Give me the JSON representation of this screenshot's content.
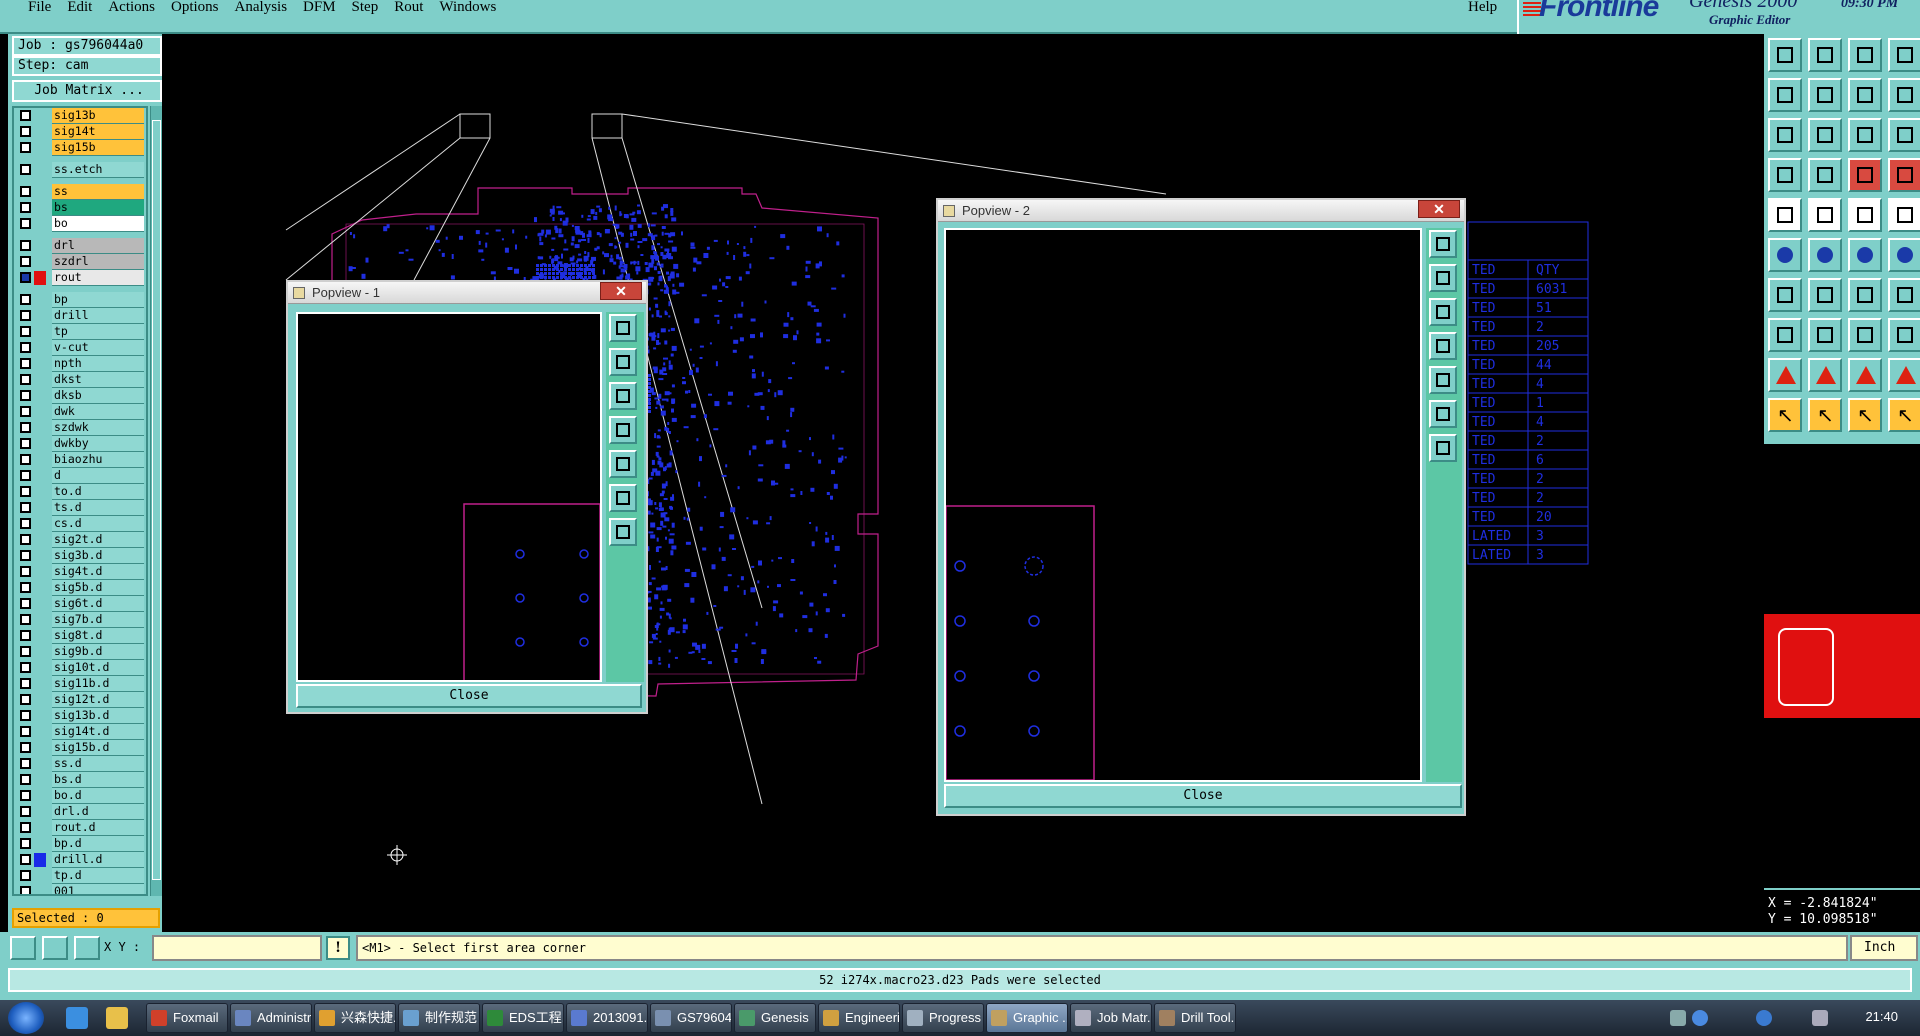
{
  "menubar": {
    "items": [
      "File",
      "Edit",
      "Actions",
      "Options",
      "Analysis",
      "DFM",
      "Step",
      "Rout",
      "Windows"
    ],
    "help": "Help"
  },
  "brand": {
    "logo": "Frontline",
    "product": "Genesis 2000",
    "subtitle": "Graphic Editor",
    "time": "09:30 PM"
  },
  "job": {
    "job_label": "Job : gs796044a0",
    "step_label": "Step: cam",
    "matrix_button": "Job Matrix ..."
  },
  "layers": [
    {
      "name": "sig13b",
      "color": "#ffc23a",
      "group": 0,
      "sel": false
    },
    {
      "name": "sig14t",
      "color": "#ffc23a",
      "group": 0,
      "sel": false
    },
    {
      "name": "sig15b",
      "color": "#ffc23a",
      "group": 0,
      "sel": false
    },
    {
      "name": "ss.etch",
      "color": "#8fd8d2",
      "group": 1,
      "sel": false
    },
    {
      "name": "ss",
      "color": "#ffc23a",
      "group": 2,
      "sel": false
    },
    {
      "name": "bs",
      "color": "#1fa87f",
      "group": 2,
      "sel": false
    },
    {
      "name": "bo",
      "color": "#ffffff",
      "group": 2,
      "sel": false
    },
    {
      "name": "drl",
      "color": "#b8b8b8",
      "group": 3,
      "sel": false
    },
    {
      "name": "szdrl",
      "color": "#b8b8b8",
      "group": 3,
      "sel": false
    },
    {
      "name": "rout",
      "color": "#e8e8e8",
      "group": 3,
      "sel": true
    },
    {
      "name": "bp",
      "color": "#8fd8d2",
      "group": 4,
      "sel": false
    },
    {
      "name": "drill",
      "color": "#8fd8d2",
      "group": 4,
      "sel": false
    },
    {
      "name": "tp",
      "color": "#8fd8d2",
      "group": 4,
      "sel": false
    },
    {
      "name": "v-cut",
      "color": "#8fd8d2",
      "group": 4,
      "sel": false
    },
    {
      "name": "npth",
      "color": "#8fd8d2",
      "group": 4,
      "sel": false
    },
    {
      "name": "dkst",
      "color": "#8fd8d2",
      "group": 4,
      "sel": false
    },
    {
      "name": "dksb",
      "color": "#8fd8d2",
      "group": 4,
      "sel": false
    },
    {
      "name": "dwk",
      "color": "#8fd8d2",
      "group": 4,
      "sel": false
    },
    {
      "name": "szdwk",
      "color": "#8fd8d2",
      "group": 4,
      "sel": false
    },
    {
      "name": "dwkby",
      "color": "#8fd8d2",
      "group": 4,
      "sel": false
    },
    {
      "name": "biaozhu",
      "color": "#8fd8d2",
      "group": 4,
      "sel": false
    },
    {
      "name": "d",
      "color": "#8fd8d2",
      "group": 4,
      "sel": false
    },
    {
      "name": "to.d",
      "color": "#8fd8d2",
      "group": 4,
      "sel": false
    },
    {
      "name": "ts.d",
      "color": "#8fd8d2",
      "group": 4,
      "sel": false
    },
    {
      "name": "cs.d",
      "color": "#8fd8d2",
      "group": 4,
      "sel": false
    },
    {
      "name": "sig2t.d",
      "color": "#8fd8d2",
      "group": 4,
      "sel": false
    },
    {
      "name": "sig3b.d",
      "color": "#8fd8d2",
      "group": 4,
      "sel": false
    },
    {
      "name": "sig4t.d",
      "color": "#8fd8d2",
      "group": 4,
      "sel": false
    },
    {
      "name": "sig5b.d",
      "color": "#8fd8d2",
      "group": 4,
      "sel": false
    },
    {
      "name": "sig6t.d",
      "color": "#8fd8d2",
      "group": 4,
      "sel": false
    },
    {
      "name": "sig7b.d",
      "color": "#8fd8d2",
      "group": 4,
      "sel": false
    },
    {
      "name": "sig8t.d",
      "color": "#8fd8d2",
      "group": 4,
      "sel": false
    },
    {
      "name": "sig9b.d",
      "color": "#8fd8d2",
      "group": 4,
      "sel": false
    },
    {
      "name": "sig10t.d",
      "color": "#8fd8d2",
      "group": 4,
      "sel": false
    },
    {
      "name": "sig11b.d",
      "color": "#8fd8d2",
      "group": 4,
      "sel": false
    },
    {
      "name": "sig12t.d",
      "color": "#8fd8d2",
      "group": 4,
      "sel": false
    },
    {
      "name": "sig13b.d",
      "color": "#8fd8d2",
      "group": 4,
      "sel": false
    },
    {
      "name": "sig14t.d",
      "color": "#8fd8d2",
      "group": 4,
      "sel": false
    },
    {
      "name": "sig15b.d",
      "color": "#8fd8d2",
      "group": 4,
      "sel": false
    },
    {
      "name": "ss.d",
      "color": "#8fd8d2",
      "group": 4,
      "sel": false
    },
    {
      "name": "bs.d",
      "color": "#8fd8d2",
      "group": 4,
      "sel": false
    },
    {
      "name": "bo.d",
      "color": "#8fd8d2",
      "group": 4,
      "sel": false
    },
    {
      "name": "drl.d",
      "color": "#8fd8d2",
      "group": 4,
      "sel": false
    },
    {
      "name": "rout.d",
      "color": "#8fd8d2",
      "group": 4,
      "sel": false
    },
    {
      "name": "bp.d",
      "color": "#8fd8d2",
      "group": 4,
      "sel": false
    },
    {
      "name": "drill.d",
      "color": "#8fd8d2",
      "group": 4,
      "sel": false,
      "swatch": "#1a2ae8"
    },
    {
      "name": "tp.d",
      "color": "#8fd8d2",
      "group": 4,
      "sel": false
    },
    {
      "name": "001",
      "color": "#8fd8d2",
      "group": 4,
      "sel": false
    }
  ],
  "selected_label": "Selected : 0",
  "popup1": {
    "title": "Popview - 1",
    "close_label": "Close",
    "close_x": "✕"
  },
  "popup2": {
    "title": "Popview - 2",
    "close_label": "Close",
    "close_x": "✕"
  },
  "drill_table": {
    "header": [
      "TED",
      "QTY"
    ],
    "rows": [
      [
        "TED",
        "6031"
      ],
      [
        "TED",
        "51"
      ],
      [
        "TED",
        "2"
      ],
      [
        "TED",
        "205"
      ],
      [
        "TED",
        "44"
      ],
      [
        "TED",
        "4"
      ],
      [
        "TED",
        "1"
      ],
      [
        "TED",
        "4"
      ],
      [
        "TED",
        "2"
      ],
      [
        "TED",
        "6"
      ],
      [
        "TED",
        "2"
      ],
      [
        "TED",
        "2"
      ],
      [
        "TED",
        "20"
      ],
      [
        "LATED",
        "3"
      ],
      [
        "LATED",
        "3"
      ]
    ]
  },
  "coords": {
    "x": "X = -2.841824\"",
    "y": "Y = 10.098518\""
  },
  "command": {
    "xy_label": "X Y :",
    "excl": "!",
    "prompt": "<M1> - Select first area corner",
    "unit": "Inch"
  },
  "status": "52 i274x.macro23.d23 Pads were selected",
  "taskbar": {
    "tasks": [
      "Foxmail",
      "Administr...",
      "兴森快捷...",
      "制作规范 ...",
      "EDS工程...",
      "2013091...",
      "GS79604...",
      "Genesis",
      "Engineeri...",
      "Progress",
      "Graphic ...",
      "Job Matr...",
      "Drill Tool..."
    ],
    "clock": "21:40"
  },
  "colors": {
    "panel": "#7fcfc9",
    "board_outline": "#c0208c",
    "pads": "#1f2ee0",
    "preview_bg": "#e01010"
  }
}
